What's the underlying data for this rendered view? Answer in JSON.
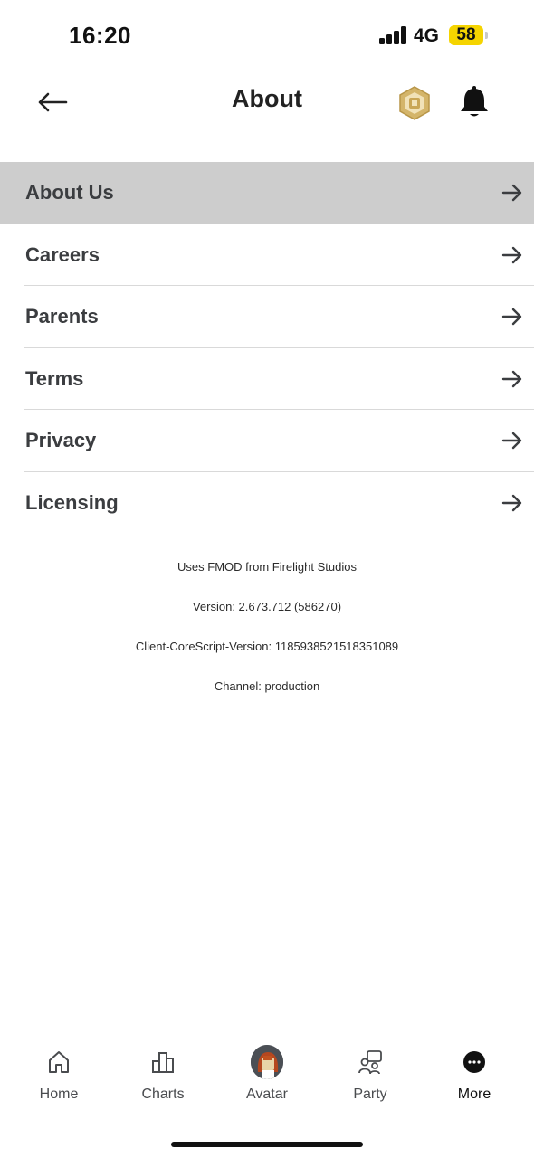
{
  "status_bar": {
    "time": "16:20",
    "network": "4G",
    "battery": "58",
    "battery_color": "#f5d400"
  },
  "header": {
    "title": "About",
    "back_icon": "arrow-left-icon",
    "currency_icon": "robux-icon",
    "notification_icon": "bell-icon"
  },
  "menu": {
    "items": [
      {
        "label": "About Us",
        "active": true
      },
      {
        "label": "Careers",
        "active": false
      },
      {
        "label": "Parents",
        "active": false
      },
      {
        "label": "Terms",
        "active": false
      },
      {
        "label": "Privacy",
        "active": false
      },
      {
        "label": "Licensing",
        "active": false
      }
    ],
    "arrow_icon": "arrow-right-icon",
    "active_bg": "#cdcdcd"
  },
  "info": {
    "fmod": "Uses FMOD from Firelight Studios",
    "version": "Version: 2.673.712 (586270)",
    "corescript": "Client-CoreScript-Version: 1185938521518351089",
    "channel": "Channel: production"
  },
  "bottom_nav": {
    "items": [
      {
        "label": "Home",
        "icon": "home-icon"
      },
      {
        "label": "Charts",
        "icon": "charts-icon"
      },
      {
        "label": "Avatar",
        "icon": "avatar-icon"
      },
      {
        "label": "Party",
        "icon": "party-icon"
      },
      {
        "label": "More",
        "icon": "more-icon",
        "selected": true
      }
    ]
  }
}
